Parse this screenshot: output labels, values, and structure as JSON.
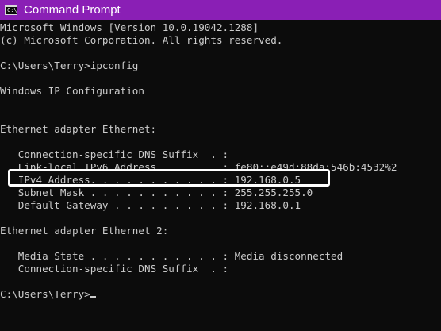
{
  "window": {
    "title": "Command Prompt",
    "icon": "command-prompt-icon",
    "icon_glyph": "C:\\",
    "title_bar_color": "#8a1fb5",
    "background_color": "#0c0c0c",
    "text_color": "#cccccc",
    "highlight_color": "#ffffff"
  },
  "console": {
    "banner_version": "Microsoft Windows [Version 10.0.19042.1288]",
    "banner_copyright": "(c) Microsoft Corporation. All rights reserved.",
    "command_line": "C:\\Users\\Terry>ipconfig",
    "header": "Windows IP Configuration",
    "adapter1": {
      "heading": "Ethernet adapter Ethernet:",
      "dns_suffix": "   Connection-specific DNS Suffix  . :",
      "ipv6": "   Link-local IPv6 Address . . . . . : fe80::e49d:88da:546b:4532%2",
      "ipv4": "   IPv4 Address. . . . . . . . . . . : 192.168.0.5",
      "subnet": "   Subnet Mask . . . . . . . . . . . : 255.255.255.0",
      "gateway": "   Default Gateway . . . . . . . . . : 192.168.0.1"
    },
    "adapter2": {
      "heading": "Ethernet adapter Ethernet 2:",
      "media_state": "   Media State . . . . . . . . . . . : Media disconnected",
      "dns_suffix": "   Connection-specific DNS Suffix  . :"
    },
    "prompt": "C:\\Users\\Terry>"
  }
}
